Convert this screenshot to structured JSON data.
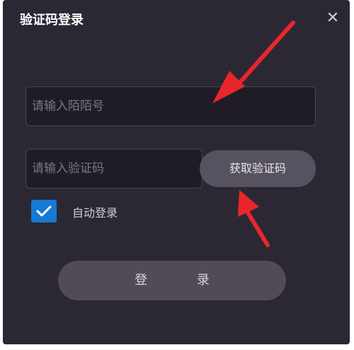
{
  "dialog": {
    "title": "验证码登录",
    "close_label": "✕"
  },
  "form": {
    "account_placeholder": "请输入陌陌号",
    "code_placeholder": "请输入验证码",
    "get_code_label": "获取验证码",
    "auto_login_label": "自动登录",
    "auto_login_checked": true,
    "login_label": "登 录"
  },
  "colors": {
    "background": "#2c2833",
    "input_bg": "#1f1c25",
    "button_bg": "#504b57",
    "checkbox_blue": "#1779d6",
    "arrow_red": "#e8262b"
  }
}
